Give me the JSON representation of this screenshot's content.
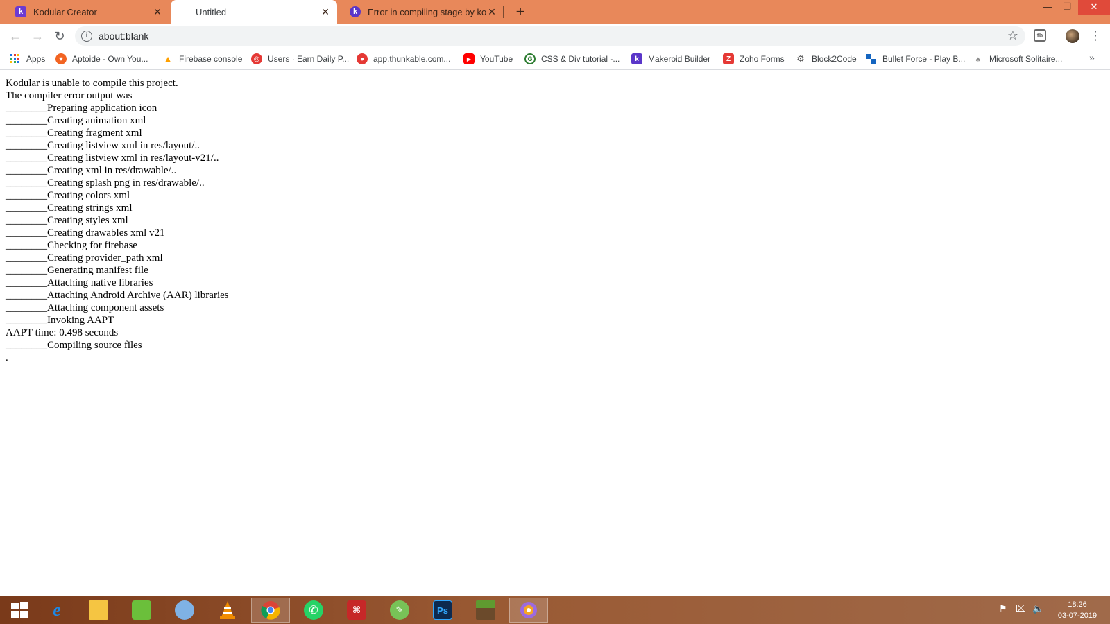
{
  "browser": {
    "tabs": [
      {
        "title": "Kodular Creator",
        "icon": "kodular-icon"
      },
      {
        "title": "Untitled",
        "icon": ""
      },
      {
        "title": "Error in compiling stage by kodu",
        "icon": "kodular-community-icon"
      }
    ],
    "url": "about:blank",
    "extension_label": "tb"
  },
  "bookmarks": [
    {
      "label": "Apps",
      "icon": "apps-grid-icon",
      "color": "#1a73e8"
    },
    {
      "label": "Aptoide - Own You...",
      "icon": "aptoide-icon",
      "color": "#f26422"
    },
    {
      "label": "Firebase console",
      "icon": "firebase-icon",
      "color": "#ffa000"
    },
    {
      "label": "Users · Earn Daily P...",
      "icon": "earn-icon",
      "color": "#e53935"
    },
    {
      "label": "app.thunkable.com...",
      "icon": "thunkable-icon",
      "color": "#e53935"
    },
    {
      "label": "YouTube",
      "icon": "youtube-icon",
      "color": "#ff0000"
    },
    {
      "label": "CSS & Div tutorial -...",
      "icon": "tutorial-icon",
      "color": "#2e7d32"
    },
    {
      "label": "Makeroid Builder",
      "icon": "makeroid-icon",
      "color": "#5a36c9"
    },
    {
      "label": "Zoho Forms",
      "icon": "zoho-icon",
      "color": "#e53935"
    },
    {
      "label": "Block2Code",
      "icon": "block2code-icon",
      "color": "#555555"
    },
    {
      "label": "Bullet Force - Play B...",
      "icon": "bulletforce-icon",
      "color": "#1565c0"
    },
    {
      "label": "Microsoft Solitaire...",
      "icon": "solitaire-icon",
      "color": "#8e8e8e"
    }
  ],
  "page": {
    "lines": [
      "Kodular is unable to compile this project.",
      "The compiler error output was",
      "________Preparing application icon",
      "________Creating animation xml",
      "________Creating fragment xml",
      "________Creating listview xml in res/layout/..",
      "________Creating listview xml in res/layout-v21/..",
      "________Creating xml in res/drawable/..",
      "________Creating splash png in res/drawable/..",
      "________Creating colors xml",
      "________Creating strings xml",
      "________Creating styles xml",
      "________Creating drawables xml v21",
      "________Checking for firebase",
      "________Creating provider_path xml",
      "________Generating manifest file",
      "________Attaching native libraries",
      "________Attaching Android Archive (AAR) libraries",
      "________Attaching component assets",
      "________Invoking AAPT",
      "AAPT time: 0.498 seconds",
      "________Compiling source files",
      "."
    ]
  },
  "taskbar": {
    "apps": [
      {
        "name": "windows-start",
        "label": "",
        "color": "#ffffff"
      },
      {
        "name": "internet-explorer",
        "label": "e",
        "color": "#1e88e5"
      },
      {
        "name": "file-explorer",
        "label": "",
        "color": "#f5c542"
      },
      {
        "name": "notepad-plus",
        "label": "",
        "color": "#6bbf3b"
      },
      {
        "name": "paint",
        "label": "",
        "color": "#7fb2e5"
      },
      {
        "name": "vlc",
        "label": "",
        "color": "#f08c00"
      },
      {
        "name": "chrome",
        "label": "",
        "color": "#4285f4"
      },
      {
        "name": "whatsapp",
        "label": "",
        "color": "#25d366"
      },
      {
        "name": "acrobat",
        "label": "",
        "color": "#c62828"
      },
      {
        "name": "android-studio",
        "label": "",
        "color": "#78c257"
      },
      {
        "name": "photoshop",
        "label": "Ps",
        "color": "#0d47a1"
      },
      {
        "name": "minecraft",
        "label": "",
        "color": "#4e7a2a"
      },
      {
        "name": "aperture-app",
        "label": "",
        "color": "#9c6ade"
      }
    ],
    "active": [
      6,
      12
    ],
    "time": "18:26",
    "date": "03-07-2019"
  }
}
